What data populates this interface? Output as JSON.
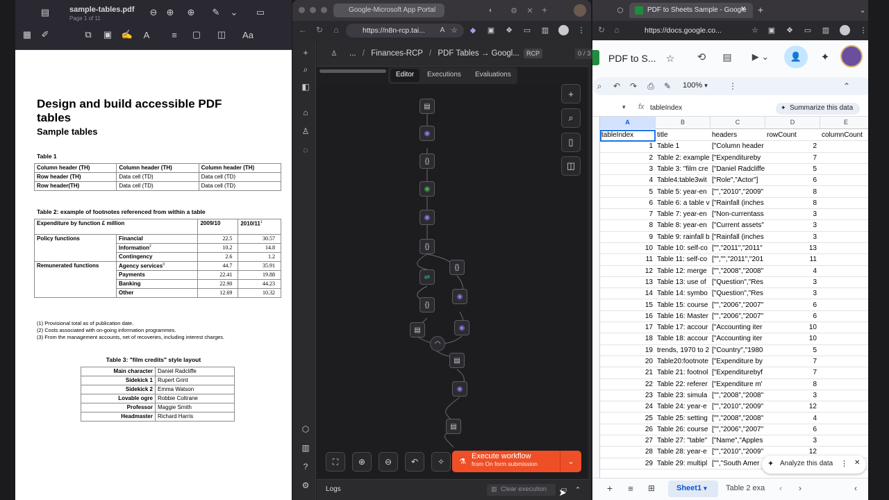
{
  "pdf": {
    "filename": "sample-tables.pdf",
    "page_info": "Page 1 of 11",
    "title": "Design and build accessible PDF tables",
    "subtitle": "Sample tables",
    "table1": {
      "caption": "Table 1",
      "rows": [
        [
          "Column header (TH)",
          "Column header (TH)",
          "Column header (TH)"
        ],
        [
          "Row header (TH)",
          "Data cell (TD)",
          "Data cell (TD)"
        ],
        [
          "Row header(TH)",
          "Data cell (TD)",
          "Data cell (TD)"
        ]
      ]
    },
    "table2": {
      "caption": "Table 2: example of footnotes referenced from within a table",
      "header": [
        "Expenditure by function £ million",
        "2009/10",
        "2010/11",
        "1"
      ],
      "group1": "Policy functions",
      "group2": "Remunerated functions",
      "rows": [
        {
          "label": "Financial",
          "sup": "",
          "a": "22.5",
          "b": "30.57"
        },
        {
          "label": "Information",
          "sup": "2",
          "a": "10.2",
          "b": "14.8"
        },
        {
          "label": "Contingency",
          "sup": "",
          "a": "2.6",
          "b": "1.2"
        },
        {
          "label": "Agency services",
          "sup": "3",
          "a": "44.7",
          "b": "35.91"
        },
        {
          "label": "Payments",
          "sup": "",
          "a": "22.41",
          "b": "19.88"
        },
        {
          "label": "Banking",
          "sup": "",
          "a": "22.90",
          "b": "44.23"
        },
        {
          "label": "Other",
          "sup": "",
          "a": "12.69",
          "b": "10.32"
        }
      ],
      "footnotes": [
        "(1) Provisional total as of publication date.",
        "(2) Costs associated with on-going information programmes.",
        "(3) From the management accounts, net of recoveries, including interest charges."
      ]
    },
    "table3": {
      "caption": "Table 3: \"film credits\" style layout",
      "rows": [
        [
          "Main character",
          "Daniel Radcliffe"
        ],
        [
          "Sidekick 1",
          "Rupert Grint"
        ],
        [
          "Sidekick 2",
          "Emma Watson"
        ],
        [
          "Lovable ogre",
          "Robbie Coltrane"
        ],
        [
          "Professor",
          "Maggie Smith"
        ],
        [
          "Headmaster",
          "Richard Harris"
        ]
      ]
    }
  },
  "n8n": {
    "tab_title": "Google-Microsoft App Portal",
    "url": "https://n8n-rcp.tai...",
    "breadcrumb": {
      "more": "...",
      "project": "Finances-RCP",
      "workflow": "PDF Tables → Googl..."
    },
    "tag": "RCP",
    "steps": "0 / 3",
    "modes": [
      "Editor",
      "Executions",
      "Evaluations"
    ],
    "execute": {
      "label": "Execute workflow",
      "sub": "from On form submission"
    },
    "logs": "Logs",
    "clear": "Clear execution"
  },
  "sheets": {
    "tab_title": "PDF to Sheets Sample - Google",
    "url": "https://docs.google.co...",
    "doc_title": "PDF to S...",
    "zoom": "100%",
    "cell_ref": "",
    "formula": "tableIndex",
    "summarize": "Summarize this data",
    "columns": [
      "A",
      "B",
      "C",
      "D",
      "E"
    ],
    "header_row": [
      "tableIndex",
      "title",
      "headers",
      "rowCount",
      "columnCount"
    ],
    "rows": [
      [
        "1",
        "Table 1",
        "[\"Column header",
        "2"
      ],
      [
        "2",
        "Table 2: example",
        "[\"Expenditureby",
        "7"
      ],
      [
        "3",
        "Table 3: \"film cre",
        "[\"Daniel Radcliffe",
        "5"
      ],
      [
        "4",
        "Table4:table3wit",
        "[\"Role\",\"Actor\"]",
        "6"
      ],
      [
        "5",
        "Table 5: year-en",
        "[\"\",\"2010\",\"2009\"",
        "8"
      ],
      [
        "6",
        "Table 6: a table v",
        "[\"Rainfall (inches",
        "8"
      ],
      [
        "7",
        "Table 7: year-en",
        "[\"Non-currentass",
        "3"
      ],
      [
        "8",
        "Table 8: year-en",
        "[\"Current assets\"",
        "3"
      ],
      [
        "9",
        "Table 9: rainfall b",
        "[\"Rainfall (inches",
        "3"
      ],
      [
        "10",
        "Table 10: self-co",
        "[\"\",\"2011\",\"2011\"",
        "13"
      ],
      [
        "11",
        "Table 11: self-co",
        "[\"\",\"\",\"2011\",\"201",
        "11"
      ],
      [
        "12",
        "Table 12: merge",
        "[\"\",\"2008\",\"2008\"",
        "4"
      ],
      [
        "13",
        "Table 13: use of",
        "[\"Question\",\"Res",
        "3"
      ],
      [
        "14",
        "Table 14: symbo",
        "[\"Question\",\"Res",
        "3"
      ],
      [
        "15",
        "Table 15: course",
        "[\"\",\"2006\",\"2007\"",
        "6"
      ],
      [
        "16",
        "Table 16: Master",
        "[\"\",\"2006\",\"2007\"",
        "6"
      ],
      [
        "17",
        "Table 17: accour",
        "[\"Accounting iter",
        "10"
      ],
      [
        "18",
        "Table 18: accour",
        "[\"Accounting iter",
        "10"
      ],
      [
        "19",
        "trends, 1970 to 2",
        "[\"Country\",\"1980",
        "5"
      ],
      [
        "20",
        "Table20:footnote",
        "[\"Expenditure by",
        "7"
      ],
      [
        "21",
        "Table 21: footnol",
        "[\"Expenditurebyf",
        "7"
      ],
      [
        "22",
        "Table 22: referer",
        "[\"Expenditure m'",
        "8"
      ],
      [
        "23",
        "Table 23: simula",
        "[\"\",\"2008\",\"2008\"",
        "3"
      ],
      [
        "24",
        "Table 24: year-e",
        "[\"\",\"2010\",\"2009\"",
        "12"
      ],
      [
        "25",
        "Table 25: setting",
        "[\"\",\"2008\",\"2008\"",
        "4"
      ],
      [
        "26",
        "Table 26: course",
        "[\"\",\"2006\",\"2007\"",
        "6"
      ],
      [
        "27",
        "Table 27: \"table\"",
        "[\"Name\",\"Apples",
        "3"
      ],
      [
        "28",
        "Table 28: year-e",
        "[\"\",\"2010\",\"2009\"",
        "12"
      ],
      [
        "29",
        "Table 29: multipl",
        "[\"\",\"South Amer",
        ""
      ]
    ],
    "analyze": "Analyze this data",
    "sheet_tabs": [
      "Sheet1",
      "Table 2 exa"
    ]
  }
}
